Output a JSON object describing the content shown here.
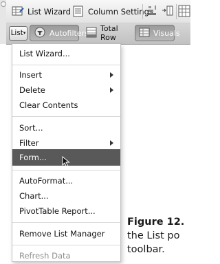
{
  "toolbar": {
    "list_wizard_label": "List Wizard",
    "column_settings_label": "Column Settings",
    "icons": [
      "list-wizard-icon",
      "column-settings-icon",
      "sort-ascending-icon",
      "insert-column-icon",
      "grid-icon"
    ]
  },
  "list_toolbar": {
    "list_label": "List",
    "autofilters_label": "Autofilters",
    "total_row_label": "Total Row",
    "visuals_label": "Visuals"
  },
  "menu": {
    "items": [
      {
        "label": "List Wizard...",
        "submenu": false,
        "enabled": true
      },
      {
        "label": "Insert",
        "submenu": true,
        "enabled": true
      },
      {
        "label": "Delete",
        "submenu": true,
        "enabled": true
      },
      {
        "label": "Clear Contents",
        "submenu": false,
        "enabled": true
      },
      {
        "label": "Sort...",
        "submenu": false,
        "enabled": true
      },
      {
        "label": "Filter",
        "submenu": true,
        "enabled": true
      },
      {
        "label": "Form...",
        "submenu": false,
        "enabled": true,
        "highlighted": true
      },
      {
        "label": "AutoFormat...",
        "submenu": false,
        "enabled": true
      },
      {
        "label": "Chart...",
        "submenu": false,
        "enabled": true
      },
      {
        "label": "PivotTable Report...",
        "submenu": false,
        "enabled": true
      },
      {
        "label": "Remove List Manager",
        "submenu": false,
        "enabled": true
      },
      {
        "label": "Refresh Data",
        "submenu": false,
        "enabled": false
      }
    ]
  },
  "caption": {
    "figure": "Figure 12.",
    "line2": "the List po",
    "line3": "toolbar."
  },
  "colors": {
    "highlight": "#595959",
    "disabled_text": "#8f8f8f"
  }
}
